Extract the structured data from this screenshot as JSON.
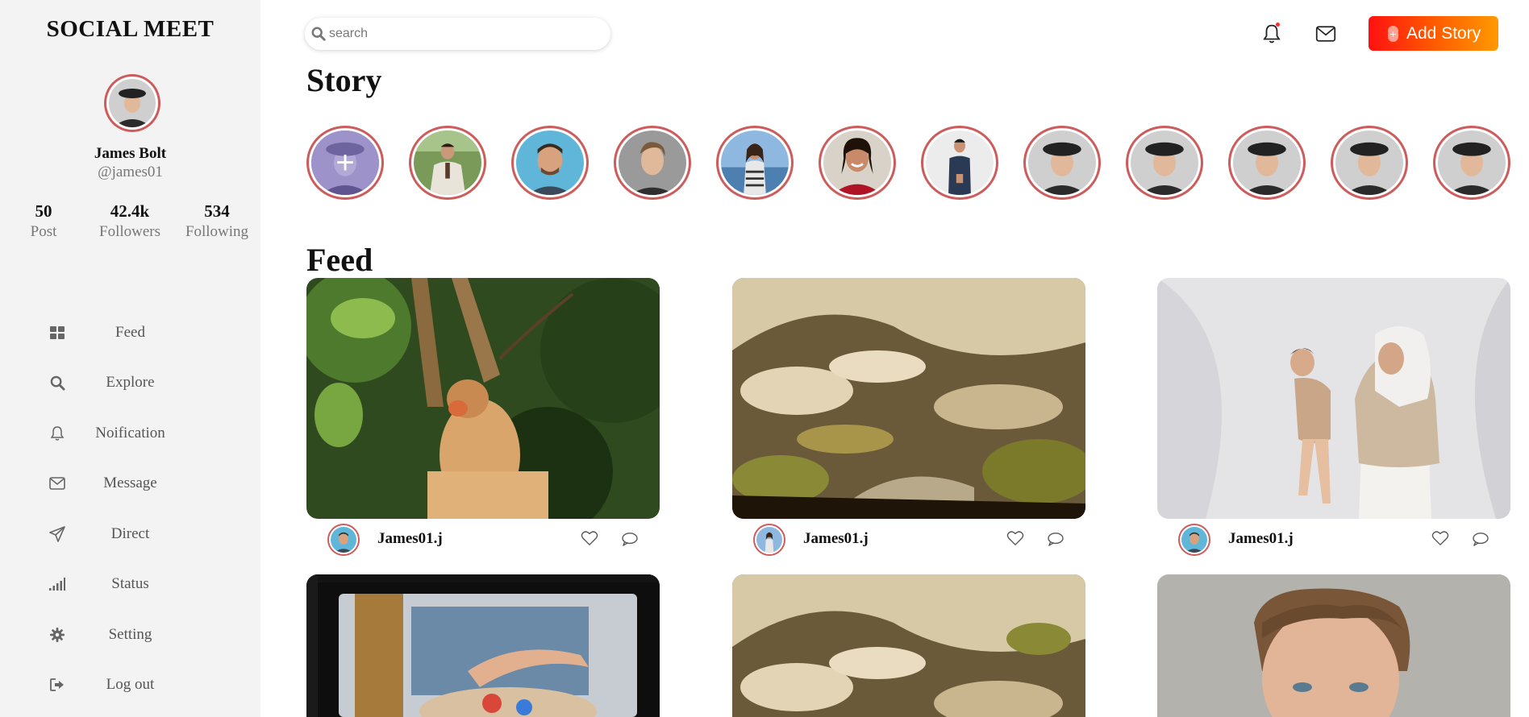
{
  "sidebar": {
    "brand": "SOCIAL MEET",
    "profile": {
      "name": "James Bolt",
      "handle": "@james01"
    },
    "stats": [
      {
        "value": "50",
        "label": "Post"
      },
      {
        "value": "42.4k",
        "label": "Followers"
      },
      {
        "value": "534",
        "label": "Following"
      }
    ],
    "nav": [
      {
        "label": "Feed",
        "icon": "grid-icon"
      },
      {
        "label": "Explore",
        "icon": "search-icon"
      },
      {
        "label": "Noification",
        "icon": "bell-icon"
      },
      {
        "label": "Message",
        "icon": "envelope-icon"
      },
      {
        "label": "Direct",
        "icon": "paper-plane-icon"
      },
      {
        "label": "Status",
        "icon": "signal-bars-icon"
      },
      {
        "label": "Setting",
        "icon": "gear-icon"
      },
      {
        "label": "Log out",
        "icon": "logout-icon"
      }
    ]
  },
  "header": {
    "search_placeholder": "search",
    "add_story_label": "Add Story",
    "accent_gradient": [
      "#ff1111",
      "#ff9900"
    ]
  },
  "stories": {
    "title": "Story",
    "count": 12
  },
  "feed": {
    "title": "Feed",
    "posts": [
      {
        "username": "James01.j",
        "photo": "proboscis monkey in tree"
      },
      {
        "username": "James01.j",
        "photo": "rocky desert trail"
      },
      {
        "username": "James01.j",
        "photo": "mother kissing child"
      },
      {
        "username": "",
        "photo": "painter at easel on film strip"
      },
      {
        "username": "",
        "photo": "rocky desert trail"
      },
      {
        "username": "",
        "photo": "portrait of young man"
      }
    ]
  },
  "colors": {
    "story_ring": "#cd5c5c",
    "sidebar_bg": "#f3f3f3"
  }
}
